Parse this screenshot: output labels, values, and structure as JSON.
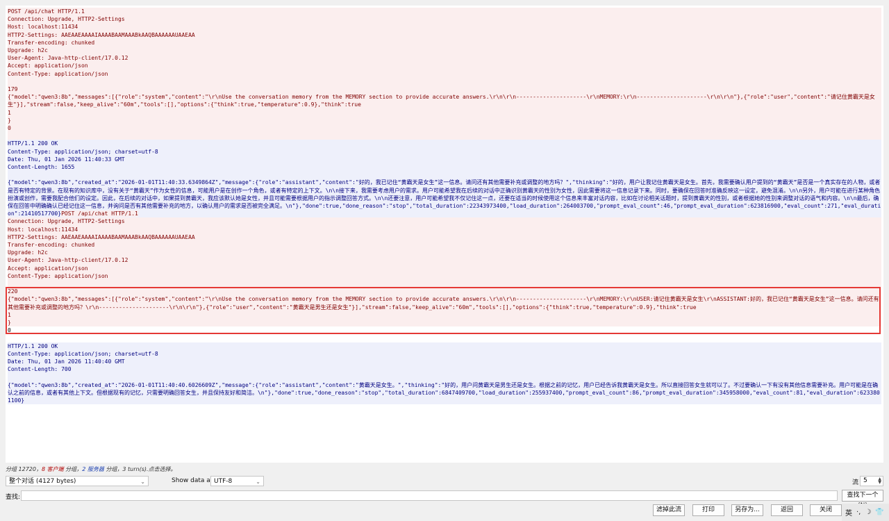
{
  "stream_lines": [
    {
      "t": "POST /api/chat HTTP/1.1",
      "k": "c"
    },
    {
      "t": "Connection: Upgrade, HTTP2-Settings",
      "k": "c"
    },
    {
      "t": "Host: localhost:11434",
      "k": "c"
    },
    {
      "t": "HTTP2-Settings: AAEAAEAAAAIAAAABAAMAAABkAAQBAAAAAAUAAEAA",
      "k": "c"
    },
    {
      "t": "Transfer-encoding: chunked",
      "k": "c"
    },
    {
      "t": "Upgrade: h2c",
      "k": "c"
    },
    {
      "t": "User-Agent: Java-http-client/17.0.12",
      "k": "c"
    },
    {
      "t": "Accept: application/json",
      "k": "c"
    },
    {
      "t": "Content-Type: application/json",
      "k": "c"
    },
    {
      "t": "",
      "k": "c"
    },
    {
      "t": "179",
      "k": "c"
    },
    {
      "t": "{\"model\":\"qwen3:8b\",\"messages\":[{\"role\":\"system\",\"content\":\"\\r\\nUse the conversation memory from the MEMORY section to provide accurate answers.\\r\\n\\r\\n---------------------\\r\\nMEMORY:\\r\\n---------------------\\r\\n\\r\\n\"},{\"role\":\"user\",\"content\":\"请记住黄霸天是女生\"}],\"stream\":false,\"keep_alive\":\"60m\",\"tools\":[],\"options\":{\"think\":true,\"temperature\":0.9},\"think\":true",
      "k": "c"
    },
    {
      "t": "1",
      "k": "c"
    },
    {
      "t": "}",
      "k": "c"
    },
    {
      "t": "0",
      "k": "c"
    },
    {
      "t": "",
      "k": "c"
    },
    {
      "t": "HTTP/1.1 200 OK",
      "k": "s"
    },
    {
      "t": "Content-Type: application/json; charset=utf-8",
      "k": "s"
    },
    {
      "t": "Date: Thu, 01 Jan 2026 11:40:33 GMT",
      "k": "s"
    },
    {
      "t": "Content-Length: 1655",
      "k": "s"
    },
    {
      "t": "",
      "k": "s"
    },
    {
      "t": "{\"model\":\"qwen3:8b\",\"created_at\":\"2026-01-01T11:40:33.6349864Z\",\"message\":{\"role\":\"assistant\",\"content\":\"好的，我已记住“黄霸天是女生”这一信息。请问还有其他需要补充或调整的地方吗？\",\"thinking\":\"好的，用户让我记住黄霸天是女生。首先，我需要确认用户提到的“黄霸天”是否是一个真实存在的人物，或者是否有特定的背景。在现有的知识库中，没有关于“黄霸天”作为女性的信息，可能用户是在创作一个角色，或者有特定的上下文。\\n\\n接下来，我需要考虑用户的需求。用户可能希望我在后续的对话中正确识别黄霸天的性别为女性，因此需要将这一信息记录下来。同时，要确保在回答时准确反映这一设定，避免混淆。\\n\\n另外，用户可能在进行某种角色扮演或创作，需要我配合他们的设定。因此，在后续的对话中，如果提到黄霸天，我应该默认她是女性，并且可能需要根据用户的指示调整回答方式。\\n\\n还要注意，用户可能希望我不仅记住这一点，还要在适当的时候使用这个信息来丰富对话内容，比如在讨论相关话题时，提到黄霸天的性别，或者根据她的性别来调整对话的语气和内容。\\n\\n最后，确保在回答中明确确认已经记住这一信息，并询问是否有其他需要补充的地方，以确认用户的需求是否被完全满足。\\n\"},\"done\":true,\"done_reason\":\"stop\",\"total_duration\":22343973400,\"load_duration\":264003700,\"prompt_eval_count\":46,\"prompt_eval_duration\":623816900,\"eval_count\":271,\"eval_duration\":21410517700}",
      "k": "s",
      "tail": "POST /api/chat HTTP/1.1"
    },
    {
      "t": "Connection: Upgrade, HTTP2-Settings",
      "k": "c"
    },
    {
      "t": "Host: localhost:11434",
      "k": "c"
    },
    {
      "t": "HTTP2-Settings: AAEAAEAAAAIAAAABAAMAAABkAAQBAAAAAAUAAEAA",
      "k": "c"
    },
    {
      "t": "Transfer-encoding: chunked",
      "k": "c"
    },
    {
      "t": "Upgrade: h2c",
      "k": "c"
    },
    {
      "t": "User-Agent: Java-http-client/17.0.12",
      "k": "c"
    },
    {
      "t": "Accept: application/json",
      "k": "c"
    },
    {
      "t": "Content-Type: application/json",
      "k": "c"
    },
    {
      "t": "",
      "k": "c"
    },
    {
      "t": "220",
      "k": "c"
    },
    {
      "t": "{\"model\":\"qwen3:8b\",\"messages\":[{\"role\":\"system\",\"content\":\"\\r\\nUse the conversation memory from the MEMORY section to provide accurate answers.\\r\\n\\r\\n---------------------\\r\\nMEMORY:\\r\\nUSER:请记住黄霸天是女生\\r\\nASSISTANT:好的，我已记住“黄霸天是女生”这一信息。请问还有其他需要补充或调整的地方吗？\\r\\n---------------------\\r\\n\\r\\n\"},{\"role\":\"user\",\"content\":\"黄霸天是男生还是女生\"}],\"stream\":false,\"keep_alive\":\"60m\",\"tools\":[],\"options\":{\"think\":true,\"temperature\":0.9},\"think\":true",
      "k": "c"
    },
    {
      "t": "1",
      "k": "c"
    },
    {
      "t": "}",
      "k": "c"
    },
    {
      "t": "0",
      "k": "n"
    },
    {
      "t": "",
      "k": "n"
    },
    {
      "t": "HTTP/1.1 200 OK",
      "k": "s"
    },
    {
      "t": "Content-Type: application/json; charset=utf-8",
      "k": "s"
    },
    {
      "t": "Date: Thu, 01 Jan 2026 11:40:40 GMT",
      "k": "s"
    },
    {
      "t": "Content-Length: 700",
      "k": "s"
    },
    {
      "t": "",
      "k": "s"
    },
    {
      "t": "{\"model\":\"qwen3:8b\",\"created_at\":\"2026-01-01T11:40:40.6026609Z\",\"message\":{\"role\":\"assistant\",\"content\":\"黄霸天是女生。\",\"thinking\":\"好的，用户问黄霸天是男生还是女生。根据之前的记忆，用户已经告诉我黄霸天是女生。所以直接回答女生就可以了。不过要确认一下有没有其他信息需要补充。用户可能是在确认之前的信息，或者有其他上下文。但根据现有的记忆，只需要明确回答女生，并且保持友好和简洁。\\n\"},\"done\":true,\"done_reason\":\"stop\",\"total_duration\":6847409700,\"load_duration\":255937400,\"prompt_eval_count\":86,\"prompt_eval_duration\":345958000,\"eval_count\":81,\"eval_duration\":6233801100}",
      "k": "s"
    }
  ],
  "summary": {
    "part1": "分组 12720，",
    "client_text": "8 客户端",
    "part2": " 分组，",
    "server_text": "2 服务器",
    "part3": " 分组，3 turn(s).点击选择。"
  },
  "controls": {
    "conversation_select": "整个对话 (4127 bytes)",
    "show_data_label": "Show data as",
    "encoding_select": "UTF-8",
    "stream_label": "流",
    "stream_value": "5",
    "find_label": "查找:",
    "find_value": "",
    "find_next": "查找下一个(N)"
  },
  "buttons": {
    "filter": "滤掉此流",
    "print": "打印",
    "save_as": "另存为...",
    "back": "返回",
    "close": "关闭"
  },
  "tray": {
    "ime": "英",
    "mode": "·,",
    "moon": "☽",
    "shirt": "👕"
  },
  "colors": {
    "client": "#800000",
    "client_bg": "#fbeeee",
    "server": "#000080",
    "server_bg": "#eef0fb",
    "highlight": "#e53935"
  }
}
